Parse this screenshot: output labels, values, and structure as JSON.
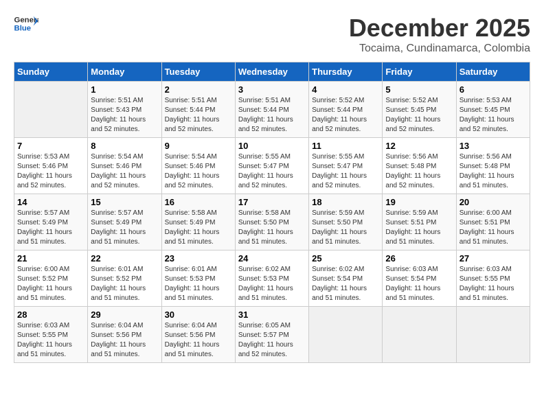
{
  "header": {
    "logo_line1": "General",
    "logo_line2": "Blue",
    "month": "December 2025",
    "location": "Tocaima, Cundinamarca, Colombia"
  },
  "weekdays": [
    "Sunday",
    "Monday",
    "Tuesday",
    "Wednesday",
    "Thursday",
    "Friday",
    "Saturday"
  ],
  "weeks": [
    [
      {
        "day": "",
        "empty": true
      },
      {
        "day": "1",
        "sunrise": "5:51 AM",
        "sunset": "5:43 PM",
        "daylight": "11 hours and 52 minutes."
      },
      {
        "day": "2",
        "sunrise": "5:51 AM",
        "sunset": "5:44 PM",
        "daylight": "11 hours and 52 minutes."
      },
      {
        "day": "3",
        "sunrise": "5:51 AM",
        "sunset": "5:44 PM",
        "daylight": "11 hours and 52 minutes."
      },
      {
        "day": "4",
        "sunrise": "5:52 AM",
        "sunset": "5:44 PM",
        "daylight": "11 hours and 52 minutes."
      },
      {
        "day": "5",
        "sunrise": "5:52 AM",
        "sunset": "5:45 PM",
        "daylight": "11 hours and 52 minutes."
      },
      {
        "day": "6",
        "sunrise": "5:53 AM",
        "sunset": "5:45 PM",
        "daylight": "11 hours and 52 minutes."
      }
    ],
    [
      {
        "day": "7",
        "sunrise": "5:53 AM",
        "sunset": "5:46 PM",
        "daylight": "11 hours and 52 minutes."
      },
      {
        "day": "8",
        "sunrise": "5:54 AM",
        "sunset": "5:46 PM",
        "daylight": "11 hours and 52 minutes."
      },
      {
        "day": "9",
        "sunrise": "5:54 AM",
        "sunset": "5:46 PM",
        "daylight": "11 hours and 52 minutes."
      },
      {
        "day": "10",
        "sunrise": "5:55 AM",
        "sunset": "5:47 PM",
        "daylight": "11 hours and 52 minutes."
      },
      {
        "day": "11",
        "sunrise": "5:55 AM",
        "sunset": "5:47 PM",
        "daylight": "11 hours and 52 minutes."
      },
      {
        "day": "12",
        "sunrise": "5:56 AM",
        "sunset": "5:48 PM",
        "daylight": "11 hours and 52 minutes."
      },
      {
        "day": "13",
        "sunrise": "5:56 AM",
        "sunset": "5:48 PM",
        "daylight": "11 hours and 51 minutes."
      }
    ],
    [
      {
        "day": "14",
        "sunrise": "5:57 AM",
        "sunset": "5:49 PM",
        "daylight": "11 hours and 51 minutes."
      },
      {
        "day": "15",
        "sunrise": "5:57 AM",
        "sunset": "5:49 PM",
        "daylight": "11 hours and 51 minutes."
      },
      {
        "day": "16",
        "sunrise": "5:58 AM",
        "sunset": "5:49 PM",
        "daylight": "11 hours and 51 minutes."
      },
      {
        "day": "17",
        "sunrise": "5:58 AM",
        "sunset": "5:50 PM",
        "daylight": "11 hours and 51 minutes."
      },
      {
        "day": "18",
        "sunrise": "5:59 AM",
        "sunset": "5:50 PM",
        "daylight": "11 hours and 51 minutes."
      },
      {
        "day": "19",
        "sunrise": "5:59 AM",
        "sunset": "5:51 PM",
        "daylight": "11 hours and 51 minutes."
      },
      {
        "day": "20",
        "sunrise": "6:00 AM",
        "sunset": "5:51 PM",
        "daylight": "11 hours and 51 minutes."
      }
    ],
    [
      {
        "day": "21",
        "sunrise": "6:00 AM",
        "sunset": "5:52 PM",
        "daylight": "11 hours and 51 minutes."
      },
      {
        "day": "22",
        "sunrise": "6:01 AM",
        "sunset": "5:52 PM",
        "daylight": "11 hours and 51 minutes."
      },
      {
        "day": "23",
        "sunrise": "6:01 AM",
        "sunset": "5:53 PM",
        "daylight": "11 hours and 51 minutes."
      },
      {
        "day": "24",
        "sunrise": "6:02 AM",
        "sunset": "5:53 PM",
        "daylight": "11 hours and 51 minutes."
      },
      {
        "day": "25",
        "sunrise": "6:02 AM",
        "sunset": "5:54 PM",
        "daylight": "11 hours and 51 minutes."
      },
      {
        "day": "26",
        "sunrise": "6:03 AM",
        "sunset": "5:54 PM",
        "daylight": "11 hours and 51 minutes."
      },
      {
        "day": "27",
        "sunrise": "6:03 AM",
        "sunset": "5:55 PM",
        "daylight": "11 hours and 51 minutes."
      }
    ],
    [
      {
        "day": "28",
        "sunrise": "6:03 AM",
        "sunset": "5:55 PM",
        "daylight": "11 hours and 51 minutes."
      },
      {
        "day": "29",
        "sunrise": "6:04 AM",
        "sunset": "5:56 PM",
        "daylight": "11 hours and 51 minutes."
      },
      {
        "day": "30",
        "sunrise": "6:04 AM",
        "sunset": "5:56 PM",
        "daylight": "11 hours and 51 minutes."
      },
      {
        "day": "31",
        "sunrise": "6:05 AM",
        "sunset": "5:57 PM",
        "daylight": "11 hours and 52 minutes."
      },
      {
        "day": "",
        "empty": true
      },
      {
        "day": "",
        "empty": true
      },
      {
        "day": "",
        "empty": true
      }
    ]
  ]
}
